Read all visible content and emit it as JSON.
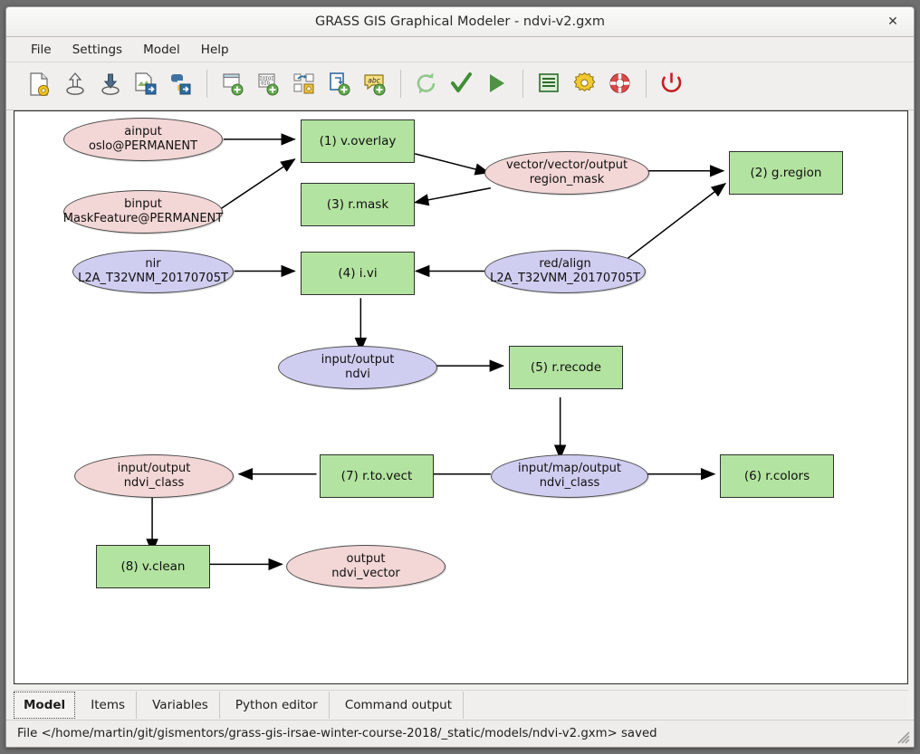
{
  "window": {
    "title": "GRASS GIS Graphical Modeler - ndvi-v2.gxm",
    "close_label": "✕"
  },
  "menubar": {
    "items": [
      {
        "label": "File"
      },
      {
        "label": "Settings"
      },
      {
        "label": "Model"
      },
      {
        "label": "Help"
      }
    ]
  },
  "toolbar": {
    "items": [
      {
        "name": "new-model-icon",
        "title": "Create new model"
      },
      {
        "name": "open-model-icon",
        "title": "Load model from file"
      },
      {
        "name": "save-model-icon",
        "title": "Save current model to file"
      },
      {
        "name": "export-image-icon",
        "title": "Export model to image"
      },
      {
        "name": "export-python-icon",
        "title": "Export model to Python script"
      },
      {
        "name": "add-command-icon",
        "title": "Add command (GRASS module) to model"
      },
      {
        "name": "add-data-icon",
        "title": "Add data to model"
      },
      {
        "name": "add-relation-icon",
        "title": "Manually define relation between data and commands"
      },
      {
        "name": "add-loop-icon",
        "title": "Add loop / series to model"
      },
      {
        "name": "add-comment-icon",
        "title": "Add comment to model"
      },
      {
        "name": "redraw-model-icon",
        "title": "Redraw model canvas"
      },
      {
        "name": "validate-model-icon",
        "title": "Validate model"
      },
      {
        "name": "run-model-icon",
        "title": "Run model"
      },
      {
        "name": "model-properties-icon",
        "title": "Show model properties"
      },
      {
        "name": "model-settings-icon",
        "title": "Modeler settings"
      },
      {
        "name": "help-icon",
        "title": "Show manual"
      },
      {
        "name": "quit-icon",
        "title": "Quit modeler"
      }
    ]
  },
  "canvas": {
    "nodes": [
      {
        "id": "ainput",
        "kind": "ellipse",
        "color": "pink",
        "line1": "ainput",
        "line2": "oslo@PERMANENT"
      },
      {
        "id": "binput",
        "kind": "ellipse",
        "color": "pink",
        "line1": "binput",
        "line2": "MaskFeature@PERMANENT"
      },
      {
        "id": "v-overlay",
        "kind": "box",
        "color": "green",
        "label": "(1) v.overlay"
      },
      {
        "id": "region-mask",
        "kind": "ellipse",
        "color": "pink",
        "line1": "vector/vector/output",
        "line2": "region_mask"
      },
      {
        "id": "g-region",
        "kind": "box",
        "color": "green",
        "label": "(2) g.region"
      },
      {
        "id": "r-mask",
        "kind": "box",
        "color": "green",
        "label": "(3) r.mask"
      },
      {
        "id": "nir",
        "kind": "ellipse",
        "color": "blue",
        "line1": "nir",
        "line2": "L2A_T32VNM_20170705T"
      },
      {
        "id": "i-vi",
        "kind": "box",
        "color": "green",
        "label": "(4) i.vi"
      },
      {
        "id": "red-align",
        "kind": "ellipse",
        "color": "blue",
        "line1": "red/align",
        "line2": "L2A_T32VNM_20170705T"
      },
      {
        "id": "ndvi",
        "kind": "ellipse",
        "color": "blue",
        "line1": "input/output",
        "line2": "ndvi"
      },
      {
        "id": "r-recode",
        "kind": "box",
        "color": "green",
        "label": "(5) r.recode"
      },
      {
        "id": "ndvi-class-in",
        "kind": "ellipse",
        "color": "blue",
        "line1": "input/map/output",
        "line2": "ndvi_class"
      },
      {
        "id": "r-colors",
        "kind": "box",
        "color": "green",
        "label": "(6) r.colors"
      },
      {
        "id": "r-to-vect",
        "kind": "box",
        "color": "green",
        "label": "(7) r.to.vect"
      },
      {
        "id": "ndvi-class-out",
        "kind": "ellipse",
        "color": "pink",
        "line1": "input/output",
        "line2": "ndvi_class"
      },
      {
        "id": "v-clean",
        "kind": "box",
        "color": "green",
        "label": "(8) v.clean"
      },
      {
        "id": "ndvi-vector",
        "kind": "ellipse",
        "color": "pink",
        "line1": "output",
        "line2": "ndvi_vector"
      }
    ],
    "colors": {
      "command": "#b3e3a0",
      "data_input": "#f3d6d6",
      "data_intermediate": "#cfcdf0",
      "edge": "#000000",
      "background": "#ffffff"
    }
  },
  "tabs": {
    "items": [
      {
        "label": "Model",
        "selected": true
      },
      {
        "label": "Items",
        "selected": false
      },
      {
        "label": "Variables",
        "selected": false
      },
      {
        "label": "Python editor",
        "selected": false
      },
      {
        "label": "Command output",
        "selected": false
      }
    ]
  },
  "statusbar": {
    "text": "File </home/martin/git/gismentors/grass-gis-irsae-winter-course-2018/_static/models/ndvi-v2.gxm> saved"
  }
}
